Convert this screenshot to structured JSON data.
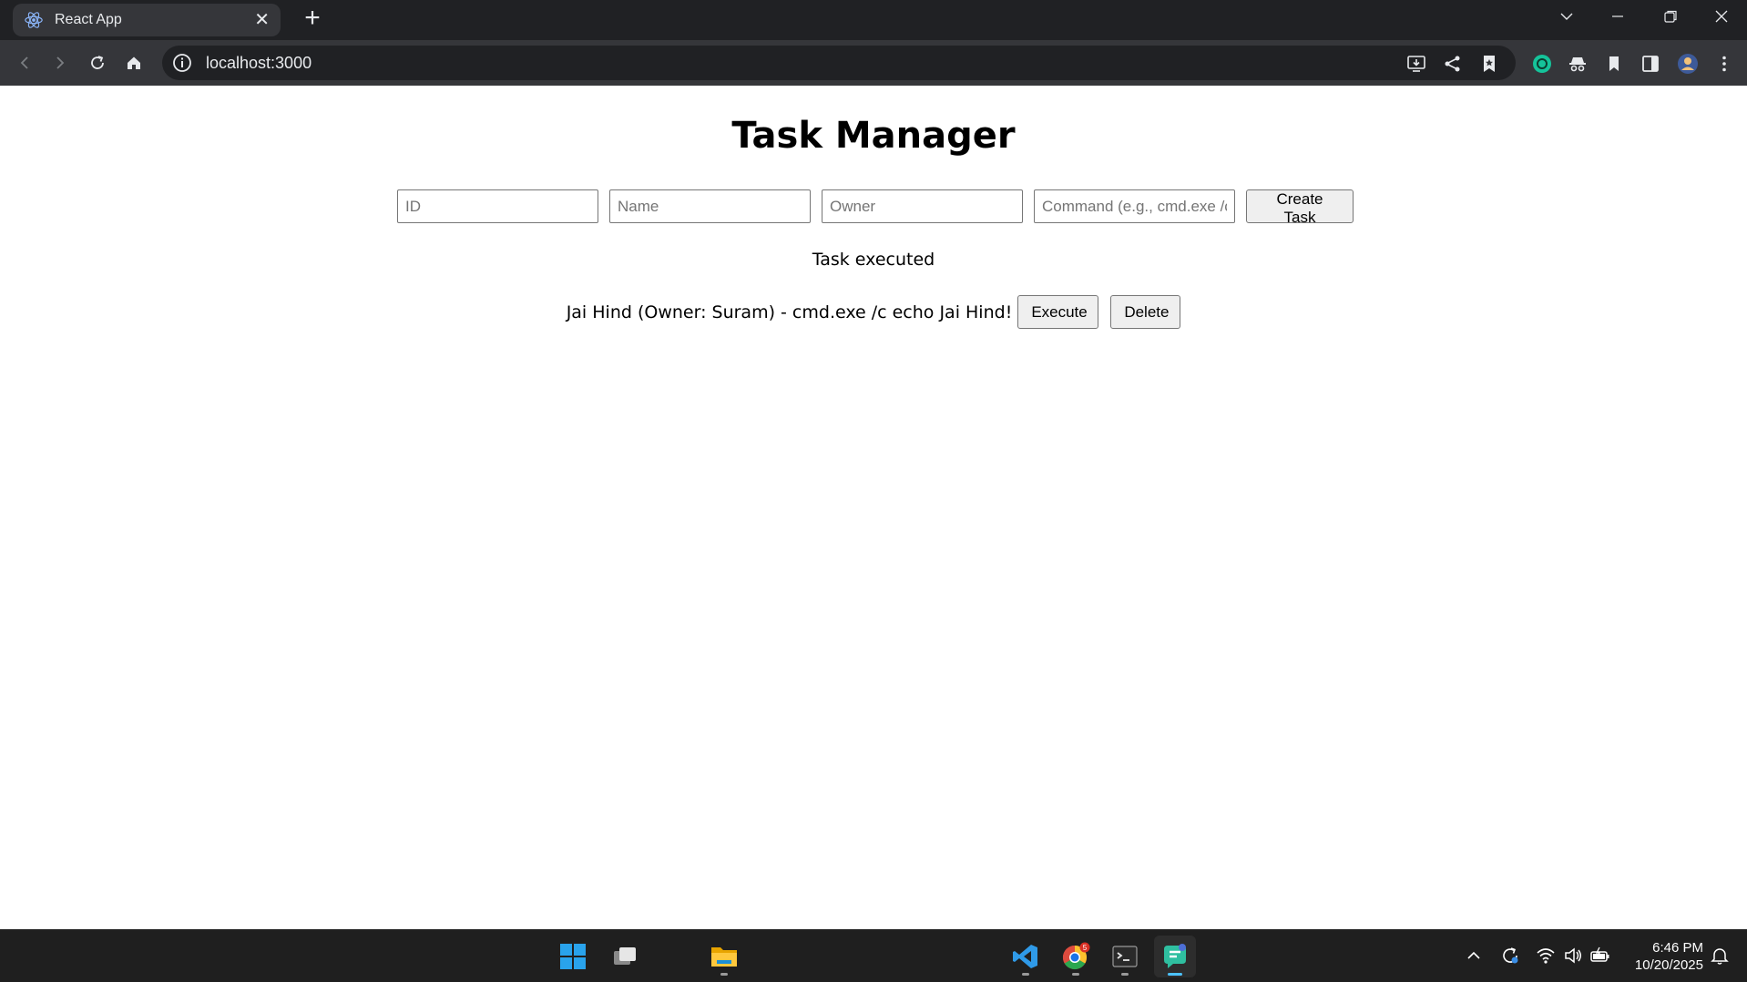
{
  "browser": {
    "tab_title": "React App",
    "url": "localhost:3000"
  },
  "app": {
    "title": "Task Manager",
    "form": {
      "id_placeholder": "ID",
      "name_placeholder": "Name",
      "owner_placeholder": "Owner",
      "command_placeholder": "Command (e.g., cmd.exe /c echo Hello)",
      "create_label": "Create Task"
    },
    "status_message": "Task executed",
    "tasks": [
      {
        "text": "Jai Hind (Owner: Suram) - cmd.exe /c echo Jai Hind!",
        "execute_label": "Execute",
        "delete_label": "Delete"
      }
    ]
  },
  "taskbar": {
    "time": "6:46 PM",
    "date": "10/20/2025",
    "chrome_badge": "5"
  },
  "colors": {
    "chrome_dark": "#202124",
    "toolbar": "#35363a",
    "taskbar": "#1f1f1f",
    "accent": "#4cc2ff"
  },
  "icons": [
    "react-icon",
    "close-icon",
    "plus-icon",
    "chevron-down-icon",
    "minimize-icon",
    "restore-icon",
    "back-icon",
    "forward-icon",
    "reload-icon",
    "home-icon",
    "info-icon",
    "install-icon",
    "share-icon",
    "bookmark-icon",
    "extension-icon",
    "incognito-icon",
    "sidepanel-icon",
    "profile-icon",
    "menu-icon",
    "windows-start-icon",
    "task-view-icon",
    "file-explorer-icon",
    "vscode-icon",
    "chrome-icon",
    "terminal-icon",
    "copilot-icon",
    "chevron-up-icon",
    "sync-icon",
    "wifi-icon",
    "volume-icon",
    "battery-icon",
    "notification-icon"
  ]
}
